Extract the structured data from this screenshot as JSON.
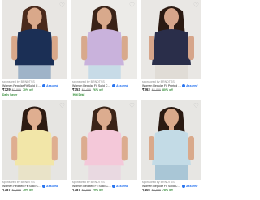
{
  "wishlist_glyph": "♡",
  "assured_label": "Assured",
  "products": [
    {
      "brand": "sponsored by BRNDTSS",
      "title": "Women Regular Fit Solid Casual",
      "price": "₹329",
      "mrp": "₹1,999",
      "off": "70% off",
      "tag": "Daily Saver",
      "colors": {
        "bg": "#e8e6e3",
        "top": "#1b2f55",
        "skin": "#d9a88a",
        "hair": "#4a2a1c",
        "bottom": "#9fb3c8"
      }
    },
    {
      "brand": "sponsored by BRNDTSS",
      "title": "Women Regular Fit Solid Casual",
      "price": "₹353",
      "mrp": "₹1,499",
      "off": "76% off",
      "tag": "Hot Deal",
      "colors": {
        "bg": "#ecebe8",
        "top": "#c9b2dc",
        "skin": "#d8a98c",
        "hair": "#3a2318",
        "bottom": "#c7dbe7"
      }
    },
    {
      "brand": "sponsored by BRNDTSS",
      "title": "Women Regular Fit Printed Casu...",
      "price": "₹363",
      "mrp": "₹1,899",
      "off": "80% off",
      "tag": "",
      "colors": {
        "bg": "#e9e7e4",
        "top": "#2a2e4a",
        "skin": "#d6a58a",
        "hair": "#2b1a12",
        "bottom": "#e0dcd6"
      }
    },
    {
      "brand": "sponsored by BRNDTSS",
      "title": "Women Relaxed Fit Solid Casual",
      "price": "₹387",
      "mrp": "₹1,899",
      "off": "79% off",
      "tag": "",
      "colors": {
        "bg": "#e6e5e2",
        "top": "#f2e6a8",
        "skin": "#dfae90",
        "hair": "#2d1b12",
        "bottom": "#e9e3c8"
      }
    },
    {
      "brand": "sponsored by BRNDTSS",
      "title": "Women Relaxed Fit Solid Casual",
      "price": "₹387",
      "mrp": "₹1,899",
      "off": "79% off",
      "tag": "",
      "colors": {
        "bg": "#e8e7e4",
        "top": "#f4c8d9",
        "skin": "#dcac8f",
        "hair": "#3b2418",
        "bottom": "#e9d9e1"
      }
    },
    {
      "brand": "sponsored by BRNDTSS",
      "title": "Women Regular Fit Solid Casual",
      "price": "₹408",
      "mrp": "₹1,899",
      "off": "78% off",
      "tag": "",
      "colors": {
        "bg": "#e7e6e3",
        "top": "#c3dbe6",
        "skin": "#d9a98b",
        "hair": "#2a1a12",
        "bottom": "#a9c6d6"
      }
    }
  ]
}
